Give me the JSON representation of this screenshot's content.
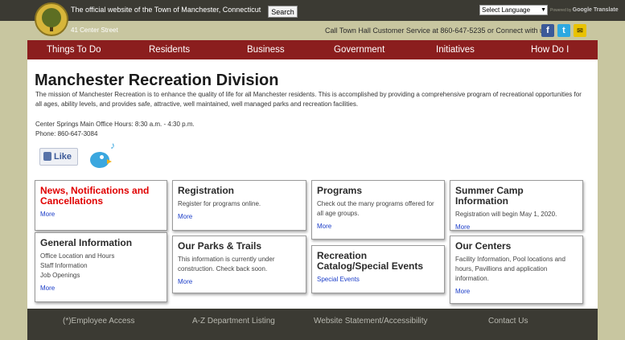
{
  "header": {
    "tagline": "The official website of the Town of Manchester, Connecticut",
    "search_label": "Search",
    "language_select": "Select Language",
    "powered_by": "Powered by",
    "translate_brand": "Google Translate",
    "address": "41 Center Street",
    "call_text": "Call Town Hall Customer Service at 860-647-5235 or Connect with us:"
  },
  "social": {
    "facebook": "f",
    "twitter": "t",
    "mail": "✉"
  },
  "nav": [
    "Things To Do",
    "Residents",
    "Business",
    "Government",
    "Initiatives",
    "How Do I"
  ],
  "main": {
    "title": "Manchester Recreation Division",
    "mission": "The mission of Manchester Recreation is to enhance the quality of life for all Manchester residents. This is accomplished by providing a comprehensive program of recreational opportunities for all ages, ability levels, and provides safe, attractive, well maintained, well managed parks and recreation facilities.",
    "hours": "Center Springs Main Office Hours: 8:30 a.m. - 4:30 p.m.",
    "phone": "Phone: 860-647-3084",
    "like_label": "Like",
    "note_glyph": "♪"
  },
  "cards": {
    "news": {
      "title": "News, Notifications and Cancellations",
      "more": "More"
    },
    "general": {
      "title": "General Information",
      "items": [
        "Office Location and Hours",
        "Staff Information",
        "Job Openings"
      ],
      "more": "More"
    },
    "registration": {
      "title": "Registration",
      "desc": "Register for programs online.",
      "more": "More"
    },
    "parks": {
      "title": "Our Parks & Trails",
      "desc": "This information is currently under construction. Check back soon.",
      "more": "More"
    },
    "programs": {
      "title": "Programs",
      "desc": "Check out the many programs offered for all age groups.",
      "more": "More"
    },
    "catalog": {
      "title": "Recreation Catalog/Special Events",
      "link": "Special Events"
    },
    "summer": {
      "title": "Summer Camp Information",
      "desc": "Registration will begin May 1, 2020.",
      "more": "More"
    },
    "centers": {
      "title": "Our Centers",
      "desc": "Facility Information, Pool locations and hours, Pavillions and application information.",
      "more": "More"
    }
  },
  "footer": [
    "(*)Employee Access",
    "A-Z Department Listing",
    "Website Statement/Accessibility",
    "Contact Us"
  ],
  "colors": {
    "nav": "#8b1e1e",
    "topbar": "#3b3a33",
    "background": "#c8c6a0",
    "link": "#1a3cc8",
    "alert": "#e00000"
  }
}
